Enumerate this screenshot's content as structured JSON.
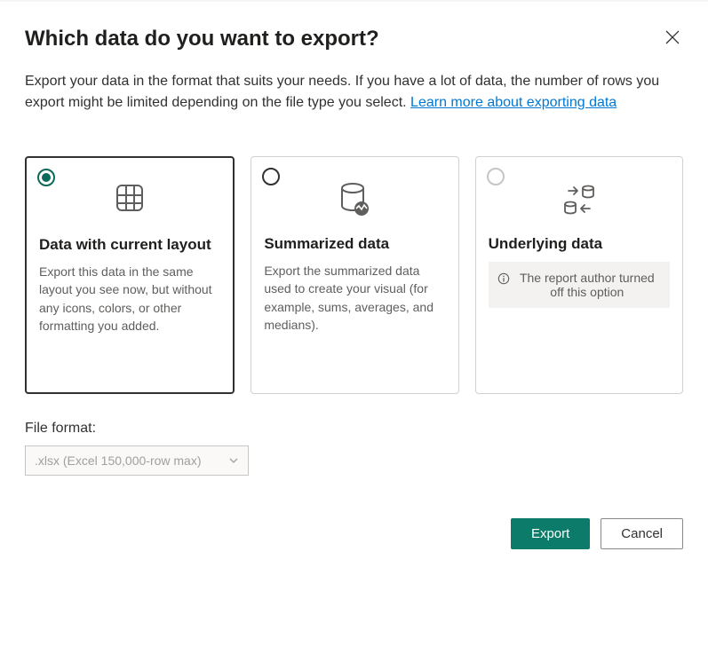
{
  "dialog": {
    "title": "Which data do you want to export?",
    "description": "Export your data in the format that suits your needs. If you have a lot of data, the number of rows you export might be limited depending on the file type you select.  ",
    "learn_link": "Learn more about exporting data"
  },
  "options": {
    "current_layout": {
      "title": "Data with current layout",
      "desc": "Export this data in the same layout you see now, but without any icons, colors, or other formatting you added.",
      "selected": true
    },
    "summarized": {
      "title": "Summarized data",
      "desc": "Export the summarized data used to create your visual (for example, sums, averages, and medians).",
      "selected": false
    },
    "underlying": {
      "title": "Underlying data",
      "disabled_msg": "The report author turned off this option",
      "selected": false,
      "disabled": true
    }
  },
  "file_format": {
    "label": "File format:",
    "selected": ".xlsx (Excel 150,000-row max)"
  },
  "actions": {
    "export": "Export",
    "cancel": "Cancel"
  }
}
